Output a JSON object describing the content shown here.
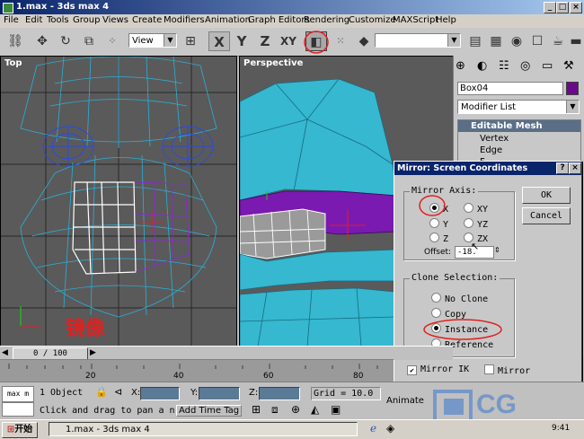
{
  "window": {
    "title": "1.max - 3ds max 4",
    "controls": [
      "_",
      "□",
      "×"
    ]
  },
  "menu": [
    "File",
    "Edit",
    "Tools",
    "Group",
    "Views",
    "Create",
    "Modifiers",
    "Animation",
    "Graph Editors",
    "Rendering",
    "Customize",
    "MAXScript",
    "Help"
  ],
  "toolbar": {
    "view_combo": "View",
    "axis_x": "X",
    "axis_y": "Y",
    "axis_z": "Z",
    "axis_xy": "XY",
    "selection_set": ""
  },
  "viewports": {
    "top_label": "Top",
    "persp_label": "Perspective",
    "annotation": "镜像"
  },
  "command_panel": {
    "object_name": "Box04",
    "object_color": "#6a0a8a",
    "modifier_list": "Modifier List",
    "stack": [
      "Editable Mesh",
      "Vertex",
      "Edge",
      "F"
    ]
  },
  "dialog": {
    "title": "Mirror: Screen Coordinates",
    "help": "?",
    "close": "×",
    "mirror_axis": "Mirror Axis:",
    "axes": [
      "X",
      "Y",
      "Z",
      "XY",
      "YZ",
      "ZX"
    ],
    "selected_axis": "X",
    "offset_label": "Offset:",
    "offset_value": "-18.",
    "ok": "OK",
    "cancel": "Cancel",
    "clone_selection": "Clone Selection:",
    "clone_options": [
      "No Clone",
      "Copy",
      "Instance",
      "Reference"
    ],
    "selected_clone": "Instance",
    "mirror_ik": "Mirror IK",
    "mirror": "Mirror"
  },
  "timeline": {
    "frame": "0 / 100",
    "ticks": [
      "20",
      "40",
      "60",
      "80"
    ]
  },
  "status": {
    "max_box": "max m",
    "selected": "1 Object",
    "x_label": "X:",
    "y_label": "Y:",
    "z_label": "Z:",
    "grid": "Grid = 10.0",
    "animate": "Animate",
    "prompt": "Click and drag to pan a n",
    "add_time_tag": "Add Time Tag"
  },
  "taskbar": {
    "start": "开始",
    "task": "1.max - 3ds max 4",
    "time": "9:41"
  },
  "watermark": "CG"
}
